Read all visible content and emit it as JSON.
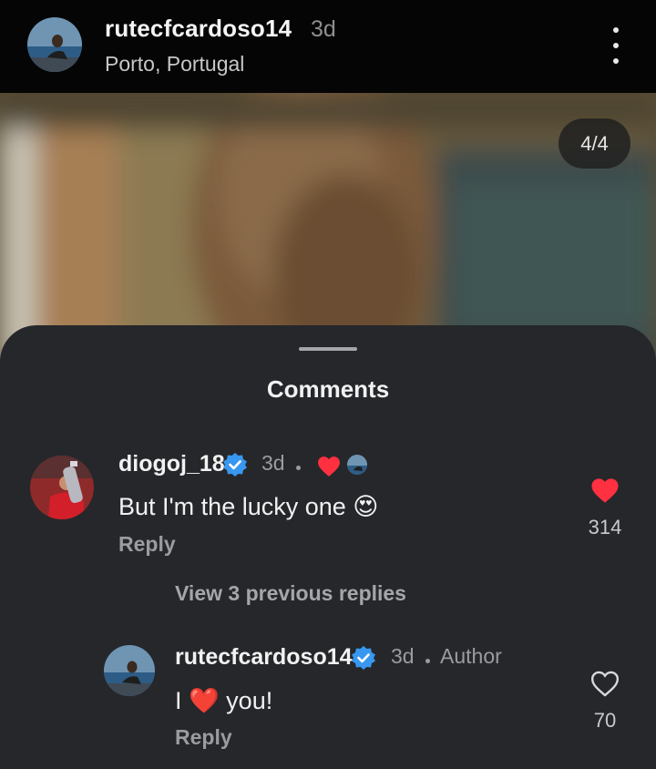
{
  "post": {
    "username": "rutecfcardoso14",
    "time": "3d",
    "location": "Porto, Portugal",
    "photo_counter": "4/4"
  },
  "comments_sheet": {
    "title": "Comments",
    "comments": [
      {
        "username": "diogoj_18",
        "verified": true,
        "time": "3d",
        "text": "But I'm the lucky one",
        "emoji": "😍",
        "reply_label": "Reply",
        "likes": "314",
        "liked": true,
        "reaction_icons": [
          "heart-icon",
          "author-avatar"
        ]
      },
      {
        "username": "rutecfcardoso14",
        "verified": true,
        "time": "3d",
        "tag": "Author",
        "text_before": "I",
        "emoji": "❤️",
        "text_after": "you!",
        "reply_label": "Reply",
        "likes": "70",
        "liked": false
      }
    ],
    "view_replies_label": "View 3 previous replies"
  },
  "colors": {
    "background": "#000000",
    "sheet": "#25272b",
    "verified": "#3897f0",
    "like_red": "#ff3040",
    "secondary_text": "#9a9ca0"
  }
}
